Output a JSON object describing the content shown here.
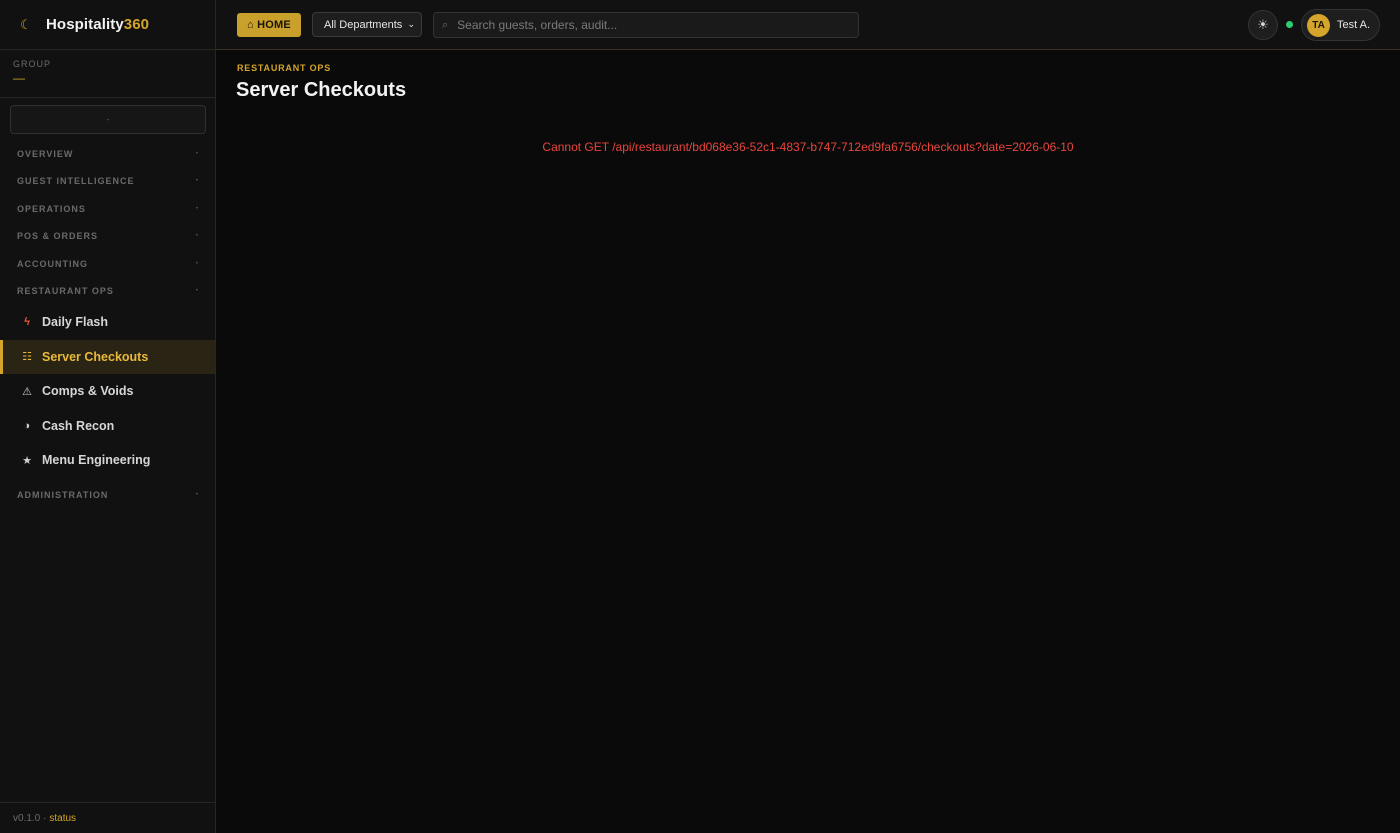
{
  "brand": {
    "name": "Hospitality",
    "accent": "360",
    "logo_glyph": "☾"
  },
  "group": {
    "label": "GROUP",
    "value": "—"
  },
  "property_select": {
    "value": "-"
  },
  "sidebar": {
    "sections_before": [
      {
        "label": "OVERVIEW"
      },
      {
        "label": "GUEST INTELLIGENCE"
      },
      {
        "label": "OPERATIONS"
      },
      {
        "label": "POS & ORDERS"
      },
      {
        "label": "ACCOUNTING"
      },
      {
        "label": "RESTAURANT OPS"
      }
    ],
    "items": [
      {
        "label": "Daily Flash",
        "icon": "flash-icon",
        "glyph": "ϟ"
      },
      {
        "label": "Server Checkouts",
        "icon": "list-icon",
        "glyph": "☷",
        "active": true
      },
      {
        "label": "Comps & Voids",
        "icon": "warning-icon",
        "glyph": "⚠"
      },
      {
        "label": "Cash Recon",
        "icon": "half-circle-icon",
        "glyph": "◑"
      },
      {
        "label": "Menu Engineering",
        "icon": "star-icon",
        "glyph": "★"
      }
    ],
    "sections_after": [
      {
        "label": "ADMINISTRATION"
      }
    ],
    "chevron_glyph": "•"
  },
  "footer": {
    "version": "v0.1.0 ·",
    "status_link": "status"
  },
  "topbar": {
    "home_label": "⌂ HOME",
    "department": "All Departments",
    "search_placeholder": "Search guests, orders, audit...",
    "theme_glyph": "☀",
    "user_initials": "TA",
    "user_name": "Test A."
  },
  "page": {
    "breadcrumb": "RESTAURANT OPS",
    "title": "Server Checkouts",
    "error": "Cannot GET /api/restaurant/bd068e36-52c1-4837-b747-712ed9fa6756/checkouts?date=2026-06-10"
  },
  "colors": {
    "accent": "#d4a52a",
    "error": "#e8453c",
    "online": "#2ecc71"
  }
}
